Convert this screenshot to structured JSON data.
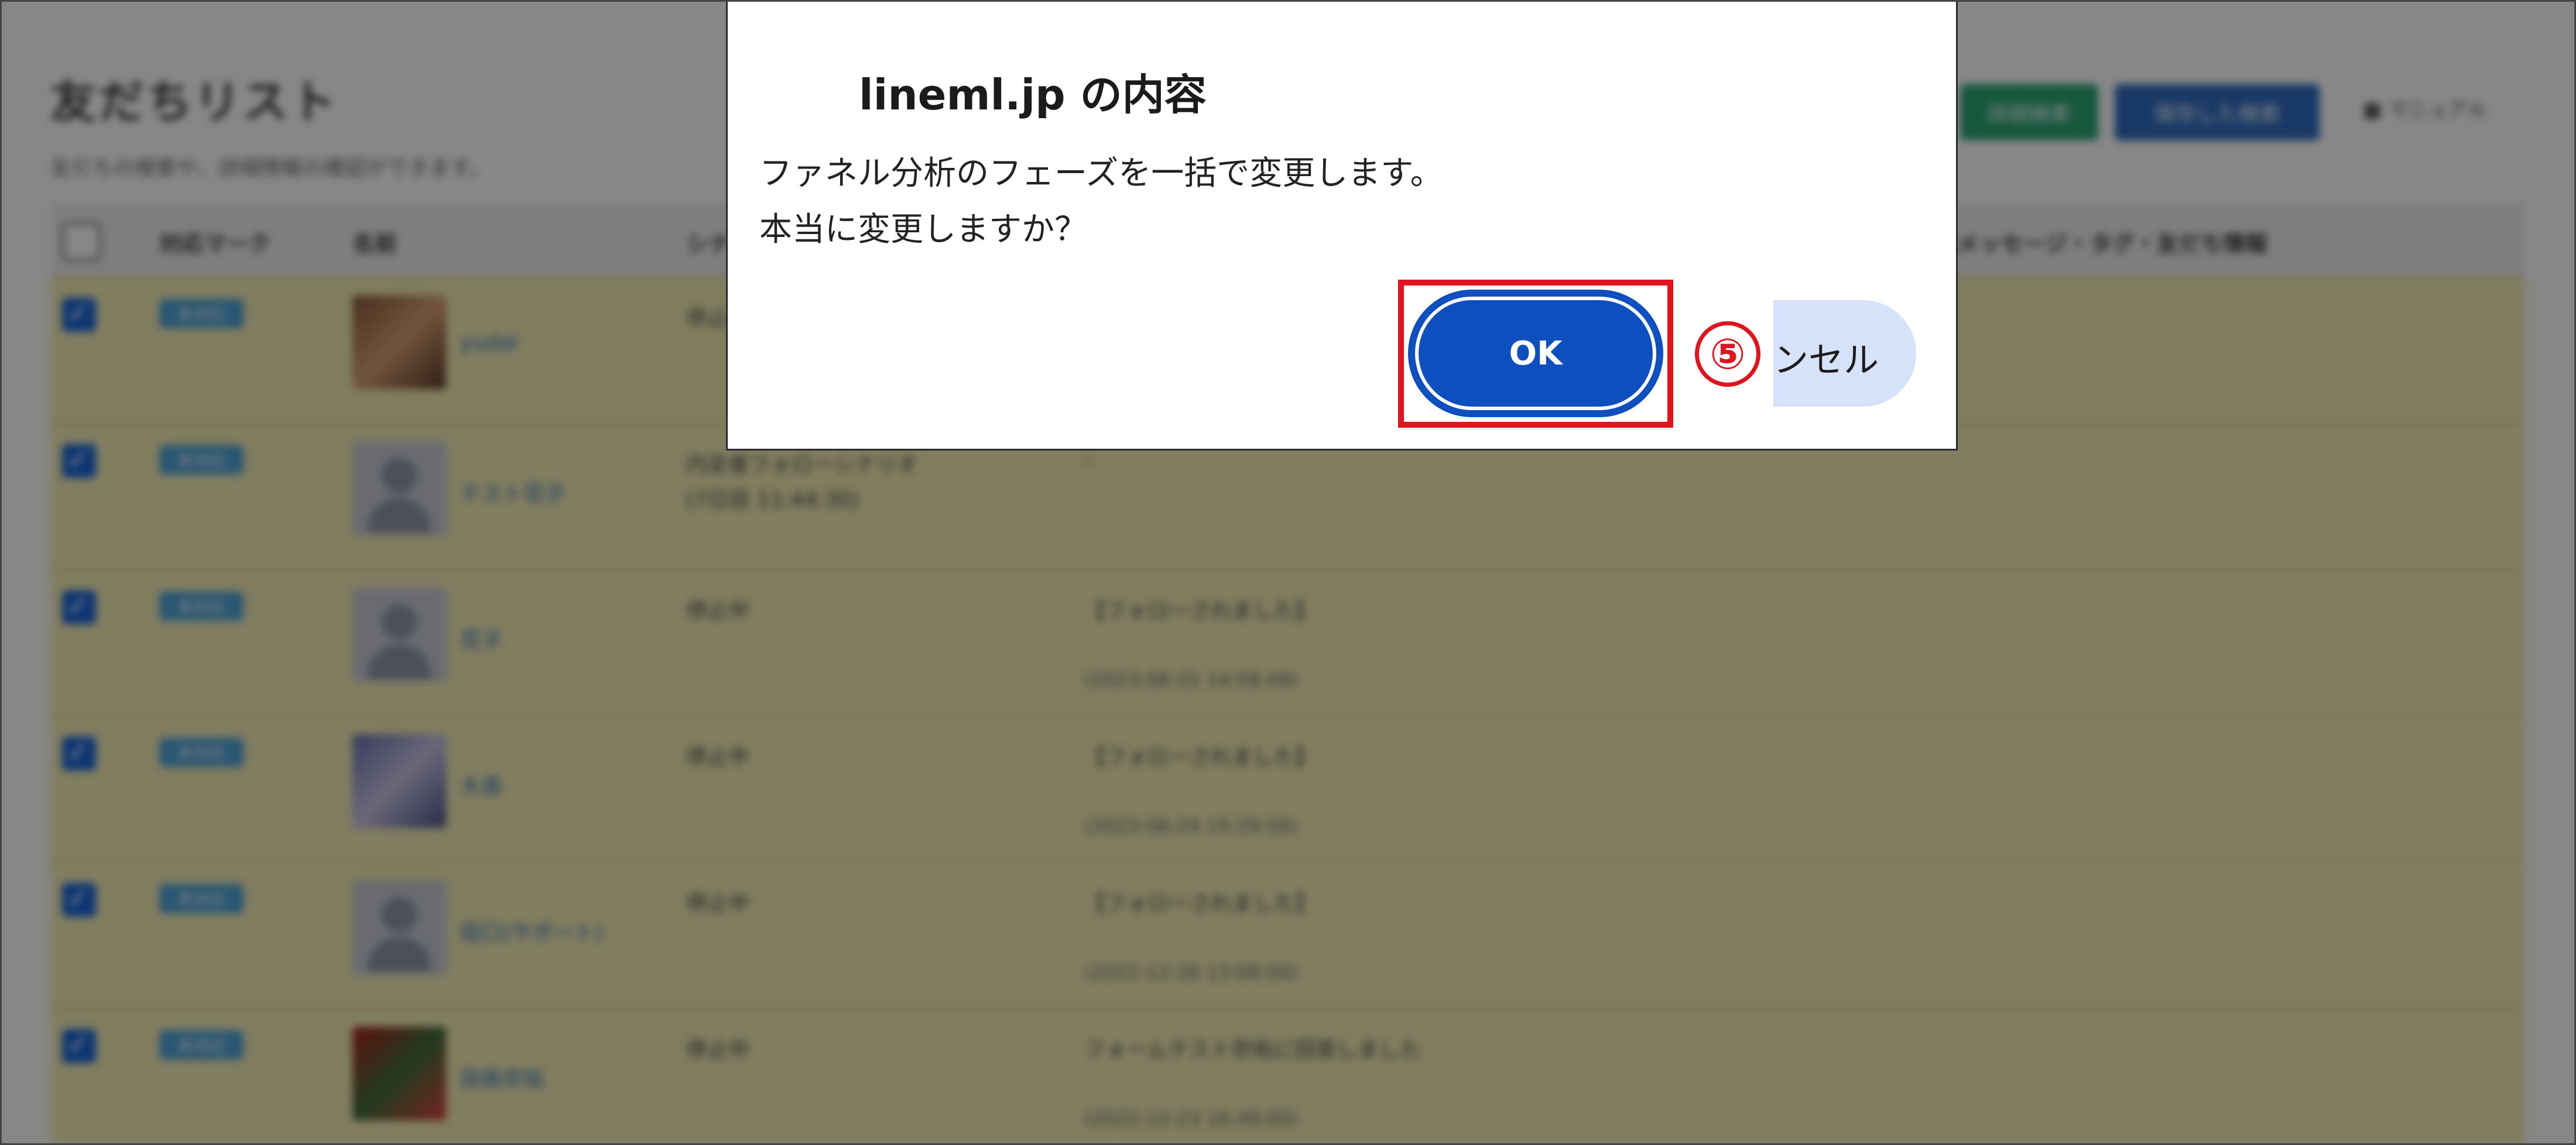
{
  "background": {
    "title": "友だちリスト",
    "subtitle": "友だちの検索や、詳細情報の確認ができます。",
    "buttons": [
      "詳細検索",
      "保存した検索"
    ],
    "manual_link": "マニュアル",
    "table_headers": [
      "対応マーク",
      "名前",
      "シナリオ",
      "最新メッセージ・タグ・友だち情報"
    ],
    "rows": [
      {
        "checked": true,
        "badge": "未対応",
        "name": "yudai",
        "status": "停止中",
        "message": "",
        "date": ""
      },
      {
        "checked": true,
        "badge": "未対応",
        "name": "テスト花子",
        "status": "内定者フォローシナリオ",
        "status2": "(7日目 11:44:30)",
        "message": "-",
        "date": ""
      },
      {
        "checked": true,
        "badge": "未対応",
        "name": "花子",
        "status": "停止中",
        "message": "【フォローされました】",
        "date": "(2023-08-25 14:58:49)"
      },
      {
        "checked": true,
        "badge": "未対応",
        "name": "大島",
        "status": "停止中",
        "message": "【フォローされました】",
        "date": "(2023-08-24 15:29:56)"
      },
      {
        "checked": true,
        "badge": "未対応",
        "name": "田口(サポート)",
        "status": "停止中",
        "message": "【フォローされました】",
        "date": "(2022-12-26 13:08:56)"
      },
      {
        "checked": true,
        "badge": "未対応",
        "name": "田島宗佑",
        "status": "停止中",
        "message": "フォームテスト宗佑に回答しました",
        "date": "(2022-12-23 16:49:00)"
      }
    ]
  },
  "dialog": {
    "title": "lineml.jp の内容",
    "message_line1": "ファネル分析のフェーズを一括で変更します。",
    "message_line2": "本当に変更しますか？",
    "ok_label": "OK",
    "cancel_label": "ンセル"
  },
  "annotation": {
    "step_number": "⑤",
    "highlight_color": "#e0141e"
  },
  "colors": {
    "ok_button": "#0d4fbf",
    "cancel_button": "#d6e2fa",
    "row_highlight": "#f3ecb6"
  }
}
